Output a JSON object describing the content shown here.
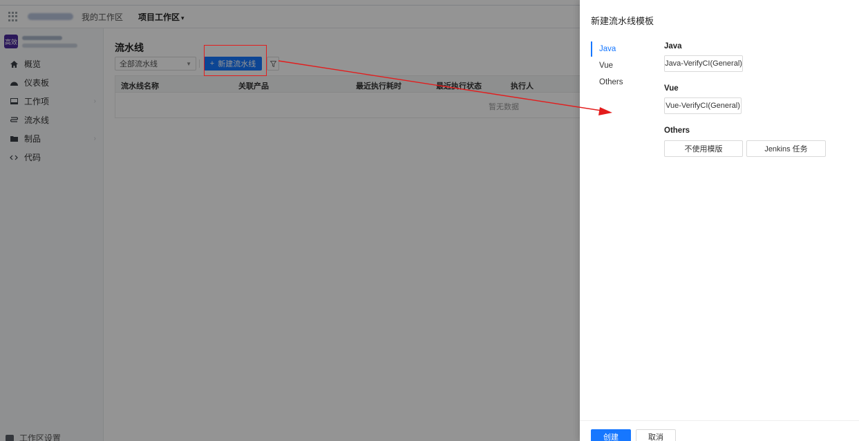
{
  "topbar": {
    "my_workspace": "我的工作区",
    "project_workspace": "项目工作区",
    "caret": "▾"
  },
  "sidebar": {
    "project_avatar": "高效",
    "items": [
      {
        "label": "概览",
        "icon": "home-icon"
      },
      {
        "label": "仪表板",
        "icon": "dashboard-icon"
      },
      {
        "label": "工作项",
        "icon": "workitem-icon",
        "chevron": "›"
      },
      {
        "label": "流水线",
        "icon": "pipeline-icon"
      },
      {
        "label": "制品",
        "icon": "artifact-icon",
        "chevron": "›"
      },
      {
        "label": "代码",
        "icon": "code-icon"
      }
    ],
    "bottom_label": "工作区设置"
  },
  "main": {
    "title": "流水线",
    "filter_value": "全部流水线",
    "new_button": "新建流水线",
    "columns": [
      "流水线名称",
      "关联产品",
      "最近执行耗时",
      "最近执行状态",
      "执行人"
    ],
    "empty_text": "暂无数据"
  },
  "drawer": {
    "title": "新建流水线模板",
    "tabs": [
      "Java",
      "Vue",
      "Others"
    ],
    "active_tab": "Java",
    "sections": [
      {
        "title": "Java",
        "templates": [
          "Java-VerifyCI(General)"
        ]
      },
      {
        "title": "Vue",
        "templates": [
          "Vue-VerifyCI(General)"
        ]
      },
      {
        "title": "Others",
        "templates": [
          "不使用模版",
          "Jenkins 任务"
        ]
      }
    ],
    "create_button": "创建",
    "cancel_button": "取消"
  },
  "colors": {
    "accent": "#1677ff",
    "annotation": "#e31c1c",
    "project_avatar": "#4a2a9c"
  }
}
